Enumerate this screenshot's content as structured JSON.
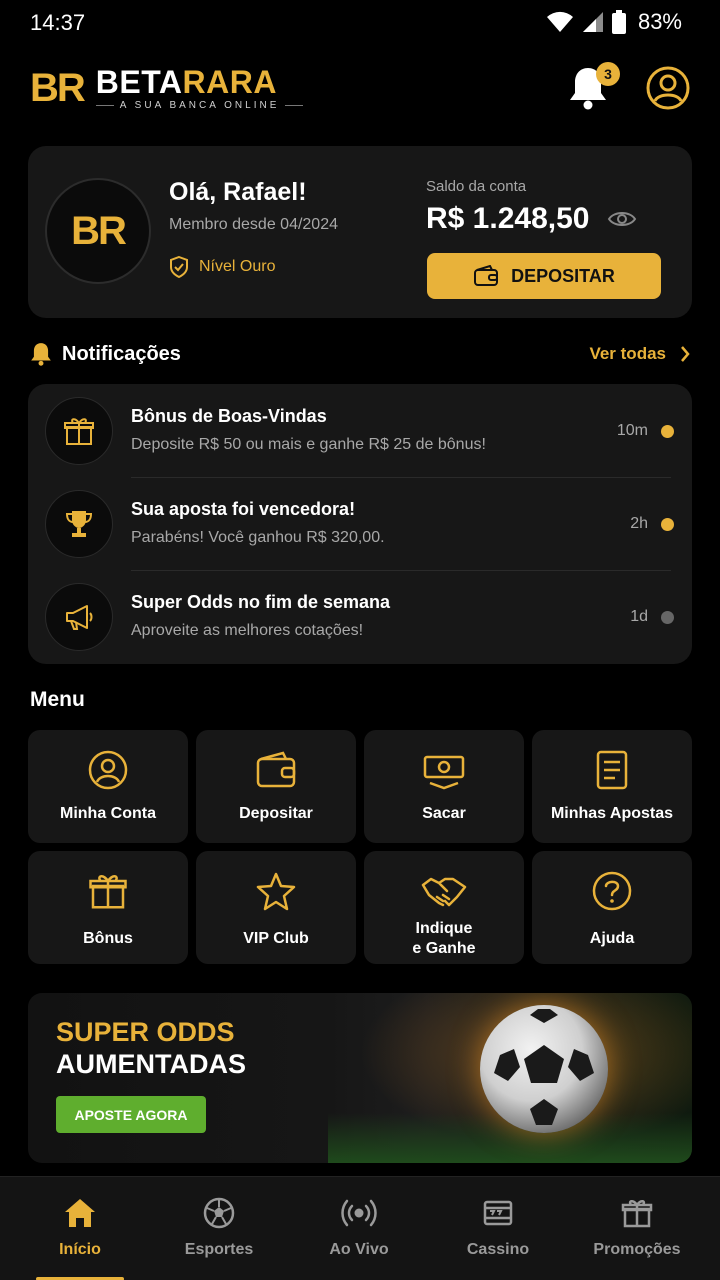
{
  "status_bar": {
    "time": "14:37",
    "battery": "83%"
  },
  "brand": {
    "mark": "BR",
    "name_part1": "BETA",
    "name_part2": "RARA",
    "tagline": "A SUA BANCA ONLINE"
  },
  "header": {
    "notification_count": "3"
  },
  "account": {
    "avatar_mark": "BR",
    "greeting": "Olá, Rafael!",
    "member_since": "Membro desde 04/2024",
    "level": "Nível Ouro",
    "balance_label": "Saldo da conta",
    "balance_value": "R$ 1.248,50",
    "deposit_label": "DEPOSITAR"
  },
  "notifications": {
    "title": "Notificações",
    "see_all": "Ver todas",
    "items": [
      {
        "icon": "gift-icon",
        "title": "Bônus de Boas-Vindas",
        "desc": "Deposite R$ 50 ou mais e ganhe R$ 25 de bônus!",
        "time": "10m",
        "unread": true
      },
      {
        "icon": "trophy-icon",
        "title": "Sua aposta foi vencedora!",
        "desc": "Parabéns! Você ganhou R$ 320,00.",
        "time": "2h",
        "unread": true
      },
      {
        "icon": "megaphone-icon",
        "title": "Super Odds no fim de semana",
        "desc": "Aproveite as melhores cotações!",
        "time": "1d",
        "unread": false
      }
    ]
  },
  "menu": {
    "title": "Menu",
    "items": [
      {
        "label": "Minha Conta",
        "icon": "user-icon"
      },
      {
        "label": "Depositar",
        "icon": "wallet-icon"
      },
      {
        "label": "Sacar",
        "icon": "cash-icon"
      },
      {
        "label": "Minhas Apostas",
        "icon": "receipt-icon"
      },
      {
        "label": "Bônus",
        "icon": "gift-icon"
      },
      {
        "label": "VIP Club",
        "icon": "star-icon"
      },
      {
        "label": "Indique\ne Ganhe",
        "icon": "handshake-icon"
      },
      {
        "label": "Ajuda",
        "icon": "help-icon"
      }
    ]
  },
  "promo": {
    "line1": "SUPER ODDS",
    "line2": "AUMENTADAS",
    "cta": "APOSTE AGORA"
  },
  "bottom_nav": [
    {
      "label": "Início",
      "icon": "home-icon",
      "active": true
    },
    {
      "label": "Esportes",
      "icon": "soccer-ball-icon",
      "active": false
    },
    {
      "label": "Ao Vivo",
      "icon": "live-icon",
      "active": false
    },
    {
      "label": "Cassino",
      "icon": "casino-icon",
      "active": false
    },
    {
      "label": "Promoções",
      "icon": "gift-icon",
      "active": false
    }
  ],
  "colors": {
    "accent": "#E8B23A",
    "background": "#000000",
    "card": "#171717",
    "cta_green": "#5FAE2E",
    "muted_dot": "#666666"
  }
}
